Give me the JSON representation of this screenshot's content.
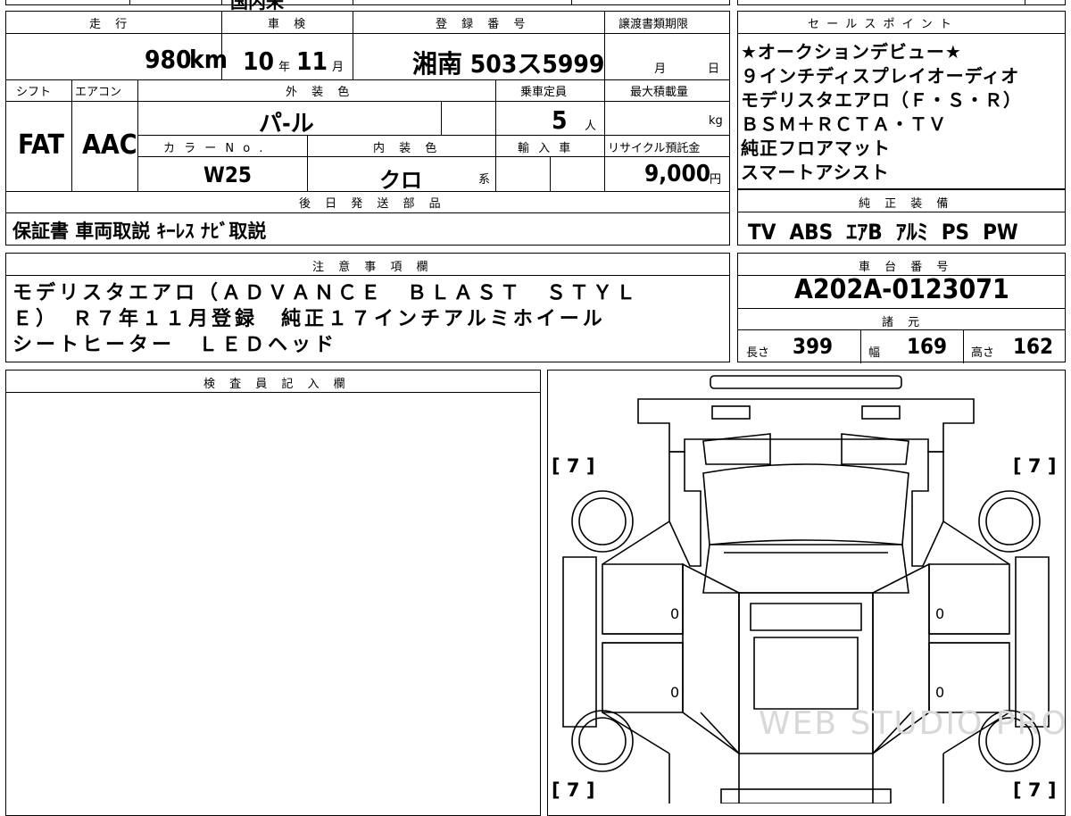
{
  "top_strip_text": "国内未",
  "main": {
    "headers": {
      "mileage": "走 行",
      "inspection": "車 検",
      "registration": "登 録 番 号",
      "transfer_deadline": "譲渡書類期限",
      "shift": "シフト",
      "aircon": "エアコン",
      "exterior_color": "外 装 色",
      "capacity": "乗車定員",
      "max_load": "最大積載量",
      "color_no": "カ ラ ー N o .",
      "interior_color": "内 装 色",
      "import": "輸 入 車",
      "recycle_fee": "リサイクル預託金",
      "later_parts": "後 日 発 送 部 品"
    },
    "values": {
      "mileage_value": "980",
      "mileage_unit": "km",
      "inspection_year": "10",
      "inspection_year_unit": "年",
      "inspection_month": "11",
      "inspection_month_unit": "月",
      "plate": "湘南 503ス5999",
      "deadline_month_unit": "月",
      "deadline_day_unit": "日",
      "shift": "FAT",
      "aircon": "AAC",
      "exterior_color": "パ-ル",
      "capacity": "5",
      "capacity_unit": "人",
      "max_load_unit": "kg",
      "color_no": "W25",
      "interior_color": "クロ",
      "interior_suffix": "系",
      "recycle_fee": "9,000",
      "recycle_unit": "円",
      "later_parts": "保証書 車両取説 ｷｰﾚｽ ﾅﾋﾞ取説"
    }
  },
  "sales_points": {
    "header": "セ ー ル ス ポ イ ン ト",
    "lines": [
      "★オークションデビュー★",
      "９インチディスプレイオーディオ",
      "モデリスタエアロ（Ｆ・Ｓ・Ｒ）",
      "ＢＳＭ＋ＲＣＴＡ・ＴＶ",
      "純正フロアマット",
      "スマートアシスト"
    ]
  },
  "genuine_equipment": {
    "header": "純 正 装 備",
    "value": "TV  ABS  ｴｱB  ｱﾙﾐ  PS  PW"
  },
  "notes": {
    "header": "注 意 事 項 欄",
    "lines": [
      "モデリスタエアロ（ＡＤＶＡＮＣＥ　ＢＬＡＳＴ　ＳＴＹＬ",
      "Ｅ）　Ｒ７年１１月登録　純正１７インチアルミホイール",
      "シートヒーター　ＬＥＤヘッド"
    ]
  },
  "chassis": {
    "header": "車 台 番 号",
    "value": "A202A-0123071"
  },
  "specs": {
    "header": "諸 元",
    "length_label": "長さ",
    "length": "399",
    "width_label": "幅",
    "width": "169",
    "height_label": "高さ",
    "height": "162"
  },
  "inspector": {
    "header": "検 査 員 記 入 欄"
  },
  "diagram": {
    "tire_labels": [
      "[ 7 ]",
      "[ 7 ]",
      "[ 7 ]",
      "[ 7 ]"
    ],
    "panel_marks": [
      "0",
      "0",
      "0",
      "0"
    ],
    "watermark": "WEB STUDIO PRO"
  }
}
